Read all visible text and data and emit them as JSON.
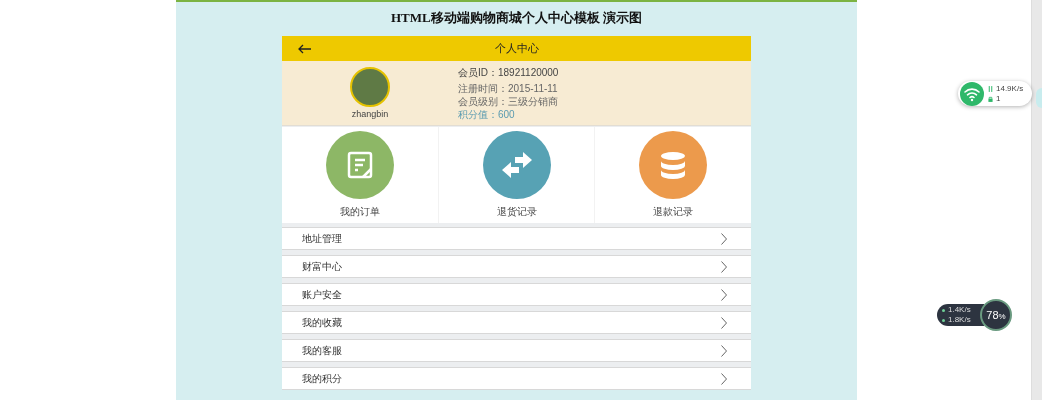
{
  "page_title": "HTML移动端购物商城个人中心模板 演示图",
  "header": {
    "title": "个人中心"
  },
  "profile": {
    "username": "zhangbin",
    "member_id": "会员ID：18921120000",
    "register_date": "注册时间：2015-11-11",
    "level": "会员级别：三级分销商",
    "points": "积分值：600"
  },
  "shortcuts": [
    {
      "label": "我的订单",
      "kind": "order",
      "color": "#8db766"
    },
    {
      "label": "退货记录",
      "kind": "return",
      "color": "#57a2b4"
    },
    {
      "label": "退款记录",
      "kind": "refund",
      "color": "#ec9a4c"
    }
  ],
  "menu": [
    {
      "label": "地址管理"
    },
    {
      "label": "财富中心"
    },
    {
      "label": "账户安全"
    },
    {
      "label": "我的收藏"
    },
    {
      "label": "我的客服"
    },
    {
      "label": "我的积分"
    }
  ],
  "network_widget": {
    "speed": "14.9K/s",
    "count": "1"
  },
  "speed_widget": {
    "upload": "1.4K/s",
    "download": "1.8K/s",
    "percent": "78",
    "percent_unit": "%"
  }
}
